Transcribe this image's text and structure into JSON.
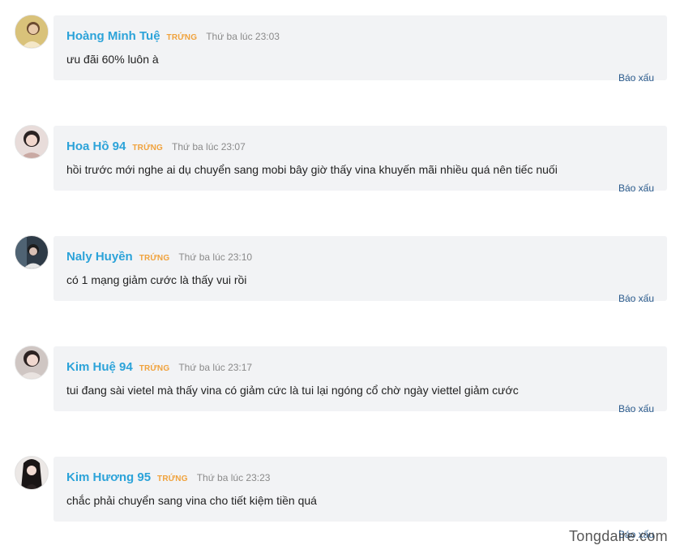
{
  "comments": [
    {
      "author": "Hoàng Minh Tuệ",
      "badge": "TRỨNG",
      "time": "Thứ ba lúc 23:03",
      "text": "ưu đãi 60% luôn à",
      "report": "Báo xấu",
      "avatar_color": "#c9a85f"
    },
    {
      "author": "Hoa Hồ 94",
      "badge": "TRỨNG",
      "time": "Thứ ba lúc 23:07",
      "text": "hồi trước mới nghe ai dụ chuyển sang mobi bây giờ thấy vina khuyến mãi nhiều quá nên tiếc nuối",
      "report": "Báo xấu",
      "avatar_color": "#d8c2bf"
    },
    {
      "author": "Naly Huyền",
      "badge": "TRỨNG",
      "time": "Thứ ba lúc 23:10",
      "text": "có 1 mạng giảm cước là thấy vui rồi",
      "report": "Báo xấu",
      "avatar_color": "#3b4a57"
    },
    {
      "author": "Kim Huệ 94",
      "badge": "TRỨNG",
      "time": "Thứ ba lúc 23:17",
      "text": "tui đang sài vietel mà thấy vina có giảm cức là tui lại ngóng cổ chờ ngày viettel giảm cước",
      "report": "Báo xấu",
      "avatar_color": "#bfb3b0"
    },
    {
      "author": "Kim Hương 95",
      "badge": "TRỨNG",
      "time": "Thứ ba lúc 23:23",
      "text": "chắc phải chuyển sang vina cho tiết kiệm tiền quá",
      "report": "Báo xấu",
      "avatar_color": "#e7e2df"
    }
  ],
  "watermark": "Tongdaire.com",
  "colors": {
    "author": "#2ca3d9",
    "badge": "#f0a23c",
    "time": "#8a8a8a",
    "bubble": "#f2f3f5",
    "report": "#2a5a8c"
  }
}
